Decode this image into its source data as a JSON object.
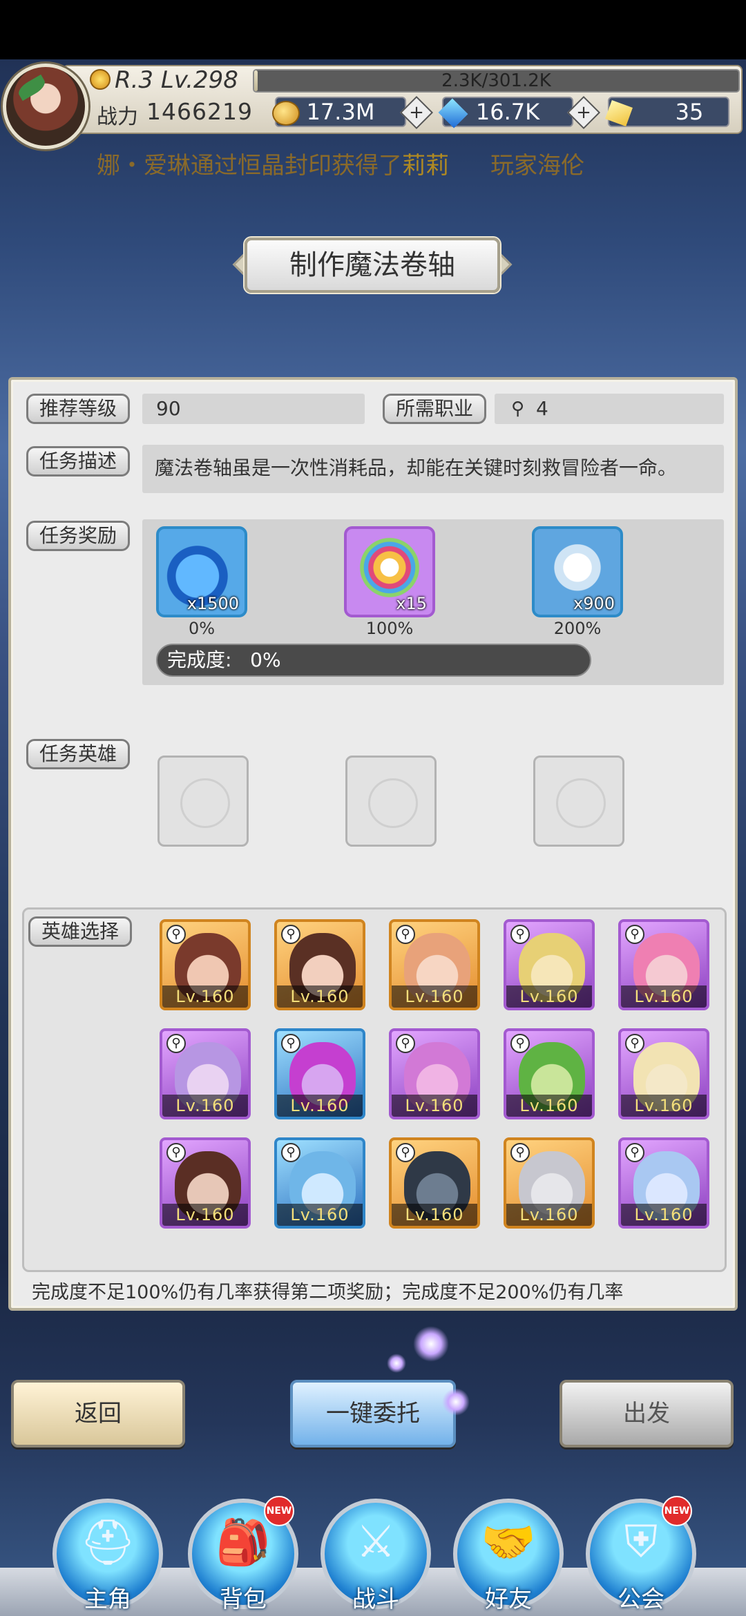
{
  "header": {
    "rank_level": "R.3 Lv.298",
    "exp_text": "2.3K/301.2K",
    "exp_progress": 0.0076,
    "power_label": "战力",
    "power_value": "1466219",
    "resources": [
      {
        "icon": "coin-icon",
        "value": "17.3M"
      },
      {
        "icon": "diamond-icon",
        "value": "16.7K"
      },
      {
        "icon": "gold-crystal-icon",
        "value": "35"
      }
    ]
  },
  "announcement": {
    "prefix": "娜・爱琳通过恒晶封印获得了",
    "highlight": "莉莉",
    "suffix": "玩家海伦"
  },
  "title": "制作魔法卷轴",
  "quest": {
    "recommended_level_label": "推荐等级",
    "recommended_level": "90",
    "required_class_label": "所需职业",
    "required_class_count": "4",
    "description_label": "任务描述",
    "description": "魔法卷轴虽是一次性消耗品，却能在关键时刻救冒险者一命。",
    "reward_label": "任务奖励",
    "rewards": [
      {
        "icon": "blue-potion-icon",
        "count": "x1500",
        "percent": "0%"
      },
      {
        "icon": "rainbow-orb-icon",
        "count": "x15",
        "percent": "100%"
      },
      {
        "icon": "crystal-ore-icon",
        "count": "x900",
        "percent": "200%"
      }
    ],
    "completion_label": "完成度:",
    "completion_value": "0%",
    "completion_progress": 0,
    "hero_label": "任务英雄",
    "hero_select_label": "英雄选择"
  },
  "heroes": [
    {
      "level": "Lv.160",
      "rarity": "orange"
    },
    {
      "level": "Lv.160",
      "rarity": "orange"
    },
    {
      "level": "Lv.160",
      "rarity": "orange"
    },
    {
      "level": "Lv.160",
      "rarity": "purple"
    },
    {
      "level": "Lv.160",
      "rarity": "purple"
    },
    {
      "level": "Lv.160",
      "rarity": "purple"
    },
    {
      "level": "Lv.160",
      "rarity": "blue"
    },
    {
      "level": "Lv.160",
      "rarity": "purple"
    },
    {
      "level": "Lv.160",
      "rarity": "purple"
    },
    {
      "level": "Lv.160",
      "rarity": "purple"
    },
    {
      "level": "Lv.160",
      "rarity": "purple"
    },
    {
      "level": "Lv.160",
      "rarity": "blue"
    },
    {
      "level": "Lv.160",
      "rarity": "orange"
    },
    {
      "level": "Lv.160",
      "rarity": "orange"
    },
    {
      "level": "Lv.160",
      "rarity": "purple"
    }
  ],
  "footer_note": "完成度不足100%仍有几率获得第二项奖励；完成度不足200%仍有几率",
  "buttons": {
    "back": "返回",
    "auto": "一键委托",
    "go": "出发"
  },
  "nav": [
    {
      "label": "主角",
      "icon": "hero-helmet-icon",
      "new": false
    },
    {
      "label": "背包",
      "icon": "backpack-icon",
      "new": true
    },
    {
      "label": "战斗",
      "icon": "crossed-swords-icon",
      "new": false
    },
    {
      "label": "好友",
      "icon": "handshake-icon",
      "new": false
    },
    {
      "label": "公会",
      "icon": "guild-crest-icon",
      "new": true
    }
  ],
  "new_badge": "NEW"
}
